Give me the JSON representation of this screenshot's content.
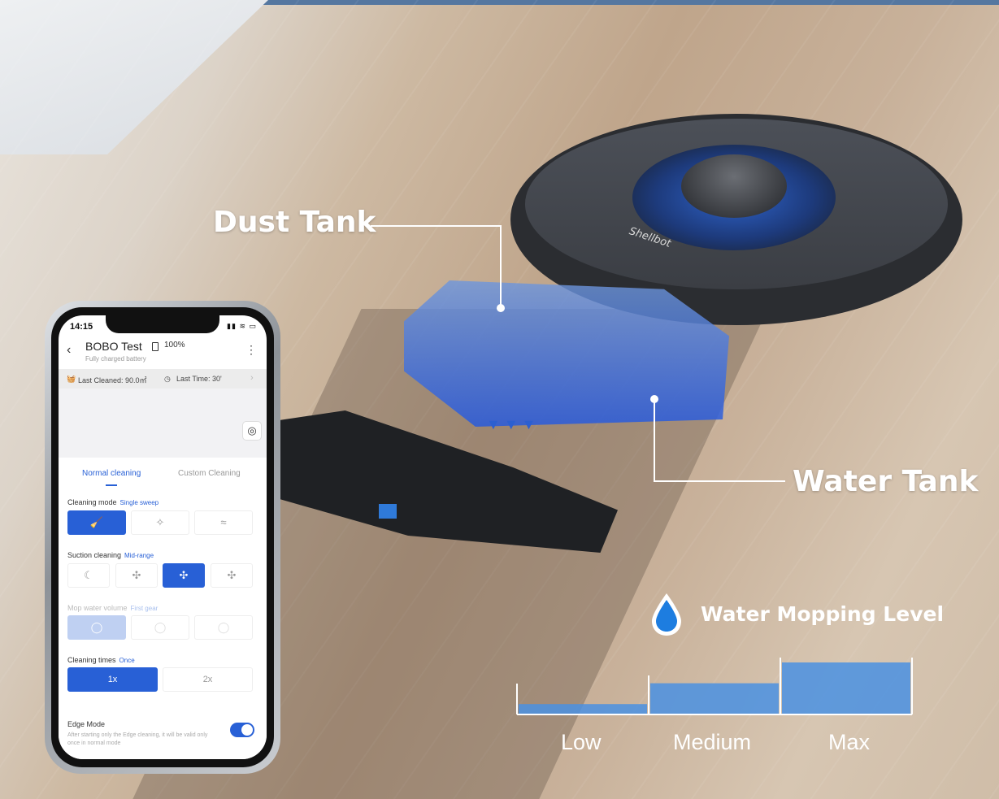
{
  "callouts": {
    "dust_tank": "Dust Tank",
    "water_tank": "Water Tank"
  },
  "robot": {
    "brand": "Shellbot"
  },
  "water_level": {
    "title": "Water Mopping Level",
    "levels": [
      "Low",
      "Medium",
      "Max"
    ],
    "fill_fractions": [
      0.2,
      0.6,
      1.0
    ],
    "accent": "#4a90e2"
  },
  "phone": {
    "status": {
      "time": "14:15",
      "icons": "▮▮ ≋ ▭"
    },
    "header": {
      "device_name": "BOBO Test",
      "battery": "100%",
      "subtitle": "Fully charged battery",
      "back_icon": "‹",
      "menu_icon": "⋮"
    },
    "stats": {
      "last_cleaned_label": "Last Cleaned: 90.0㎡",
      "last_time_label": "Last Time: 30'",
      "chevron": "›"
    },
    "tabs": [
      "Normal cleaning",
      "Custom Cleaning"
    ],
    "cleaning_mode": {
      "label": "Cleaning mode",
      "value": "Single sweep"
    },
    "suction": {
      "label": "Suction cleaning",
      "value": "Mid-range"
    },
    "mop_water": {
      "label": "Mop water volume",
      "value": "First gear"
    },
    "cleaning_times": {
      "label": "Cleaning times",
      "value": "Once",
      "options": [
        "1x",
        "2x"
      ]
    },
    "edge_mode": {
      "title": "Edge Mode",
      "desc": "After starting only the Edge cleaning, it will be valid only once in normal mode"
    },
    "accent": "#2860d6"
  }
}
